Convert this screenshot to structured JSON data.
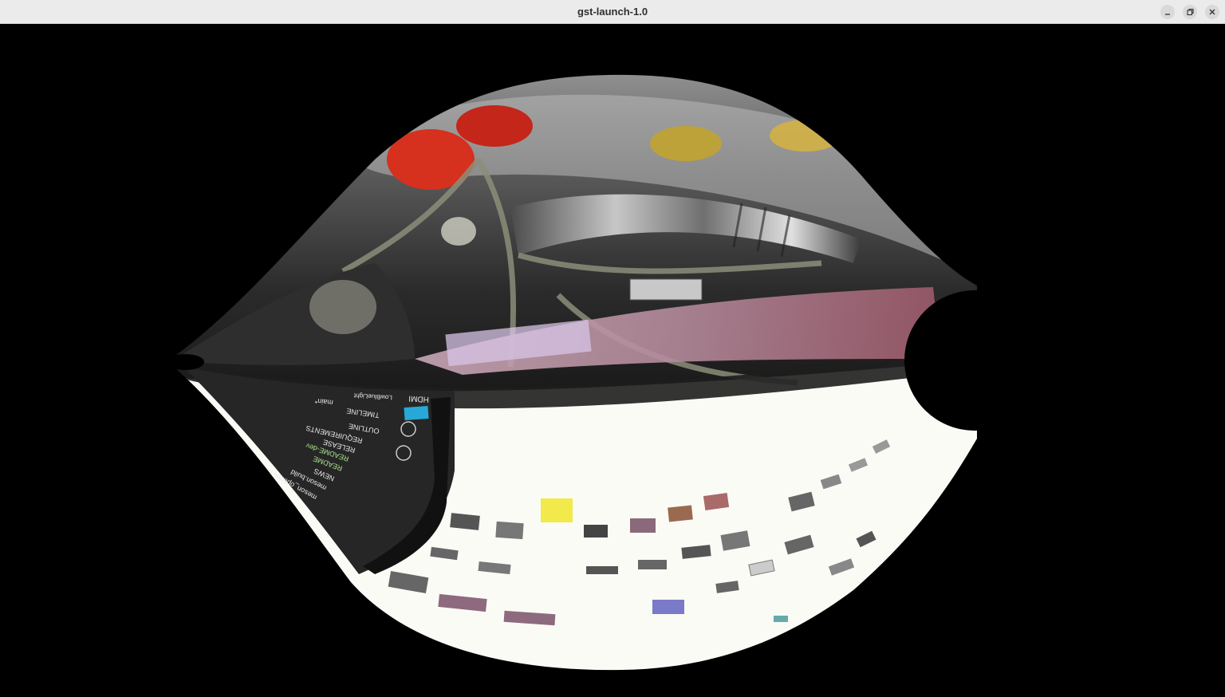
{
  "window": {
    "title": "gst-launch-1.0"
  },
  "titlebar": {
    "buttons": [
      {
        "name": "minimize",
        "icon": "minimize-icon"
      },
      {
        "name": "maximize",
        "icon": "restore-icon"
      },
      {
        "name": "close",
        "icon": "close-icon"
      }
    ]
  },
  "video": {
    "overlay_text": {
      "hdmi": "HDMI",
      "lowbluelight": "LowBlueLight",
      "branch": "main*",
      "timeline": "TIMELINE",
      "outline": "OUTLINE",
      "requirements": "REQUIREMENTS",
      "release": "RELEASE",
      "readme_dev": "README-dev",
      "readme": "README",
      "news": "NEWS",
      "meson_build": "meson.build",
      "meson_options": "meson_options.txt"
    },
    "colors": {
      "background": "#000000",
      "titlebar": "#ebebeb",
      "scene_white": "#fbfbf6",
      "scene_dark": "#2a2a2a",
      "accent_red": "#d6301f",
      "accent_yellow": "#d9b43a",
      "accent_cyan": "#28a8d8"
    }
  }
}
